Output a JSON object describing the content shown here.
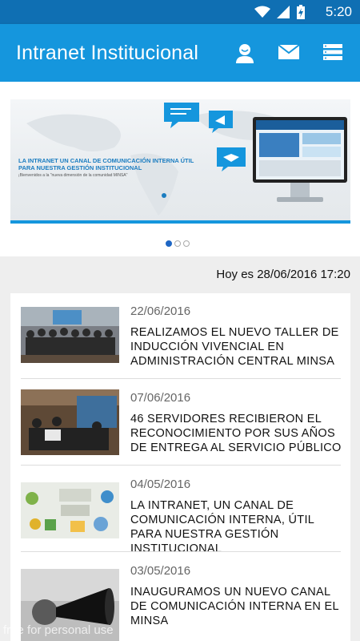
{
  "status_bar": {
    "time": "5:20",
    "icons": [
      "wifi-icon",
      "signal-icon",
      "battery-icon"
    ]
  },
  "app_bar": {
    "title": "Intranet Institucional",
    "actions": [
      "profile-icon",
      "mail-icon",
      "menu-list-icon"
    ]
  },
  "banner": {
    "headline": "LA INTRANET UN CANAL DE COMUNICACIÓN INTERNA ÚTIL PARA NUESTRA GESTIÓN INSTITUCIONAL",
    "subline": "¡Bienvenidos a la \"nueva dimensión de la comunidad MINSA\"",
    "slides": 3,
    "active_slide": 1
  },
  "today_label": "Hoy es 28/06/2016 17:20",
  "news": [
    {
      "date": "22/06/2016",
      "title": "REALIZAMOS EL NUEVO TALLER DE INDUCCIÓN VIVENCIAL EN ADMINISTRACIÓN CENTRAL MINSA"
    },
    {
      "date": "07/06/2016",
      "title": "46 SERVIDORES RECIBIERON EL RECONOCIMIENTO POR SUS AÑOS DE ENTREGA AL SERVICIO PÚBLICO"
    },
    {
      "date": "04/05/2016",
      "title": "LA INTRANET, UN CANAL DE COMUNICACIÓN INTERNA, ÚTIL PARA NUESTRA GESTIÓN INSTITUCIONAL"
    },
    {
      "date": "03/05/2016",
      "title": "INAUGURAMOS UN NUEVO CANAL DE COMUNICACIÓN INTERNA EN EL MINSA"
    }
  ],
  "watermark": "free for personal use",
  "colors": {
    "primary": "#1596dd",
    "status_bar": "#0f6fb3",
    "active_dot": "#1e66c4"
  }
}
